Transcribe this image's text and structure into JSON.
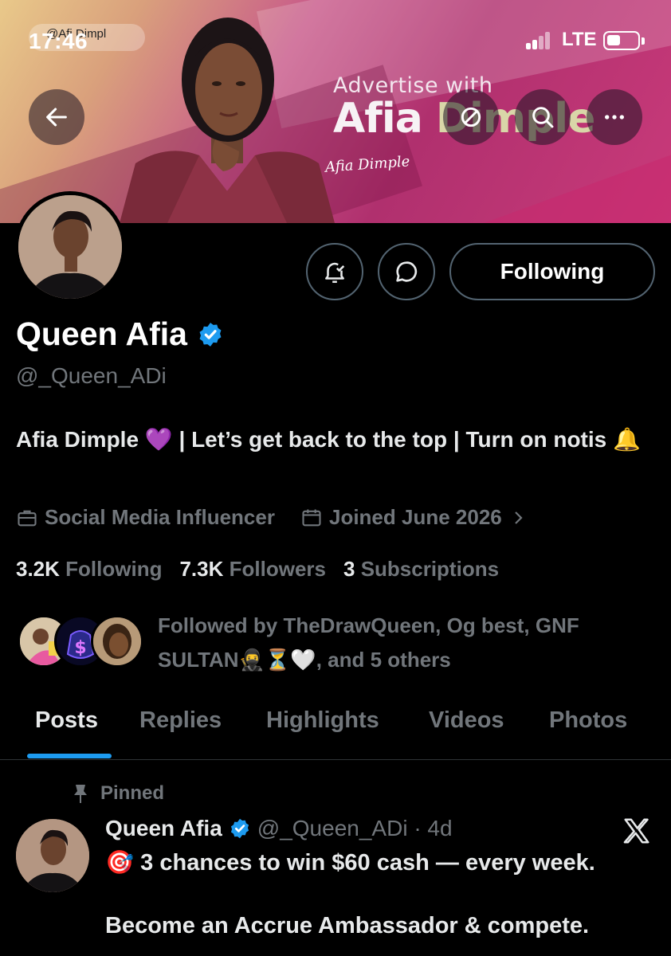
{
  "status_bar": {
    "time": "17:46",
    "pill_text": "@Afi Dimpl",
    "network": "LTE"
  },
  "banner": {
    "line1": "Advertise with",
    "line2_a": "Afia ",
    "line2_b": "Dimple",
    "signature": "Afia Dimple"
  },
  "profile": {
    "name": "Queen Afia",
    "handle": "@_Queen_ADi",
    "bio": "Afia Dimple 💜 | Let’s get back to the top | Turn on notis 🔔",
    "category": "Social Media Influencer",
    "joined": "Joined June 2026",
    "following_count": "3.2K",
    "following_label": "Following",
    "followers_count": "7.3K",
    "followers_label": "Followers",
    "subscriptions_count": "3",
    "subscriptions_label": "Subscriptions",
    "followed_by": "Followed by TheDrawQueen, Og best, GNF SULTAN🥷⏳🤍, and 5 others"
  },
  "actions": {
    "follow_label": "Following"
  },
  "tabs": [
    {
      "label": "Posts",
      "active": true
    },
    {
      "label": "Replies"
    },
    {
      "label": "Highlights"
    },
    {
      "label": "Videos"
    },
    {
      "label": "Photos"
    }
  ],
  "pinned_post": {
    "pinned_label": "Pinned",
    "author": "Queen Afia",
    "handle_time": "@_Queen_ADi · 4d",
    "line1": "🎯 3 chances to win $60 cash — every week.",
    "line2": "Become an Accrue Ambassador & compete."
  },
  "colors": {
    "verified": "#1d9bf0",
    "tab_underline": "#1d9bf0",
    "muted": "#71767b",
    "background": "#000000"
  }
}
